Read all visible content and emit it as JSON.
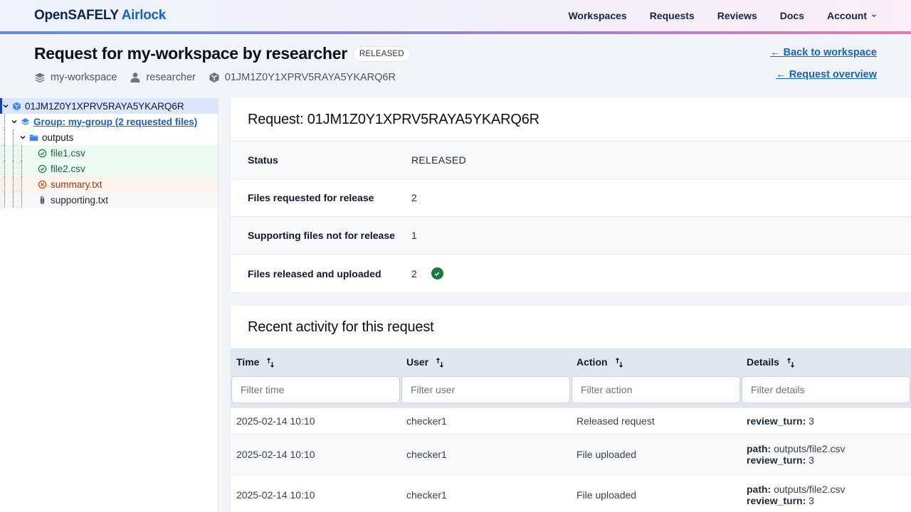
{
  "header": {
    "brand_primary": "OpenSAFELY",
    "brand_secondary": "Airlock",
    "nav": [
      {
        "label": "Workspaces"
      },
      {
        "label": "Requests"
      },
      {
        "label": "Reviews"
      },
      {
        "label": "Docs"
      },
      {
        "label": "Account",
        "icon": "chevron-down-icon"
      }
    ]
  },
  "page": {
    "title": "Request for my-workspace by researcher",
    "status_badge": "RELEASED",
    "meta": {
      "workspace": "my-workspace",
      "user": "researcher",
      "request_id": "01JM1Z0Y1XPRV5RAYA5YKARQ6R"
    },
    "back_to_workspace": "← Back to workspace",
    "request_overview": "← Request overview"
  },
  "tree": {
    "root": {
      "label": "01JM1Z0Y1XPRV5RAYA5YKARQ6R",
      "icon": "request-icon"
    },
    "group": {
      "label": "Group: my-group (2 requested files)",
      "icon": "group-icon"
    },
    "folder": {
      "label": "outputs",
      "icon": "folder-icon"
    },
    "files": [
      {
        "label": "file1.csv",
        "state": "approved",
        "icon": "check-circle-icon"
      },
      {
        "label": "file2.csv",
        "state": "approved",
        "icon": "check-circle-icon"
      },
      {
        "label": "summary.txt",
        "state": "rejected",
        "icon": "x-circle-icon"
      },
      {
        "label": "supporting.txt",
        "state": "supporting",
        "icon": "paperclip-icon"
      }
    ]
  },
  "request_panel": {
    "title": "Request: 01JM1Z0Y1XPRV5RAYA5YKARQ6R",
    "rows": [
      {
        "key": "Status",
        "value": "RELEASED"
      },
      {
        "key": "Files requested for release",
        "value": "2"
      },
      {
        "key": "Supporting files not for release",
        "value": "1"
      },
      {
        "key": "Files released and uploaded",
        "value": "2",
        "icon": "check-circle-filled-icon"
      }
    ]
  },
  "activity": {
    "title": "Recent activity for this request",
    "columns": [
      {
        "label": "Time",
        "filter_placeholder": "Filter time"
      },
      {
        "label": "User",
        "filter_placeholder": "Filter user"
      },
      {
        "label": "Action",
        "filter_placeholder": "Filter action"
      },
      {
        "label": "Details",
        "filter_placeholder": "Filter details"
      }
    ],
    "rows": [
      {
        "time": "2025-02-14 10:10",
        "user": "checker1",
        "action": "Released request",
        "details": [
          {
            "k": "review_turn:",
            "v": "3"
          }
        ]
      },
      {
        "time": "2025-02-14 10:10",
        "user": "checker1",
        "action": "File uploaded",
        "details": [
          {
            "k": "path:",
            "v": "outputs/file2.csv"
          },
          {
            "k": "review_turn:",
            "v": "3"
          }
        ]
      },
      {
        "time": "2025-02-14 10:10",
        "user": "checker1",
        "action": "File uploaded",
        "details": [
          {
            "k": "path:",
            "v": "outputs/file2.csv"
          },
          {
            "k": "review_turn:",
            "v": "3"
          }
        ]
      }
    ]
  }
}
